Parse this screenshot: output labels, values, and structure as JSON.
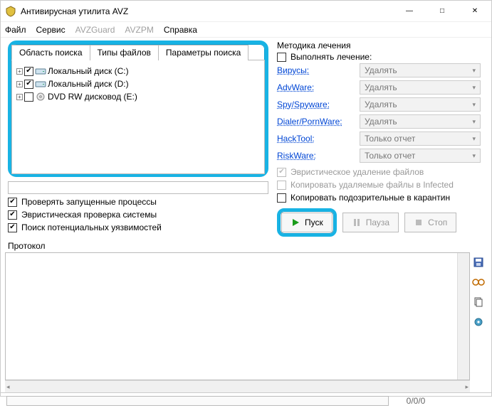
{
  "title": "Антивирусная утилита AVZ",
  "menu": {
    "file": "Файл",
    "service": "Сервис",
    "avzguard": "AVZGuard",
    "avzpm": "AVZPM",
    "help": "Справка"
  },
  "tabs": {
    "scan_area": "Область поиска",
    "file_types": "Типы файлов",
    "search_params": "Параметры поиска"
  },
  "drives": [
    {
      "checked": true,
      "label": "Локальный диск (C:)"
    },
    {
      "checked": true,
      "label": "Локальный диск (D:)"
    },
    {
      "checked": false,
      "label": "DVD RW дисковод (E:)"
    }
  ],
  "left_opts": {
    "running_procs": "Проверять запущенные процессы",
    "heuristic_sys": "Эвристическая проверка системы",
    "vuln_search": "Поиск потенциальных уязвимостей"
  },
  "right": {
    "heading": "Методика лечения",
    "do_treat": "Выполнять лечение:",
    "rows": [
      {
        "name": "Вирусы:",
        "action": "Удалять"
      },
      {
        "name": "AdvWare:",
        "action": "Удалять"
      },
      {
        "name": "Spy/Spyware:",
        "action": "Удалять"
      },
      {
        "name": "Dialer/PornWare:",
        "action": "Удалять"
      },
      {
        "name": "HackTool:",
        "action": "Только отчет"
      },
      {
        "name": "RiskWare:",
        "action": "Только отчет"
      }
    ],
    "heur_del": "Эвристическое удаление файлов",
    "copy_infected": "Копировать удаляемые файлы в  Infected",
    "copy_quar": "Копировать подозрительные в  карантин",
    "btn_start": "Пуск",
    "btn_pause": "Пауза",
    "btn_stop": "Стоп"
  },
  "protocol_label": "Протокол",
  "status": {
    "counter": "0/0/0",
    "blank": " "
  }
}
